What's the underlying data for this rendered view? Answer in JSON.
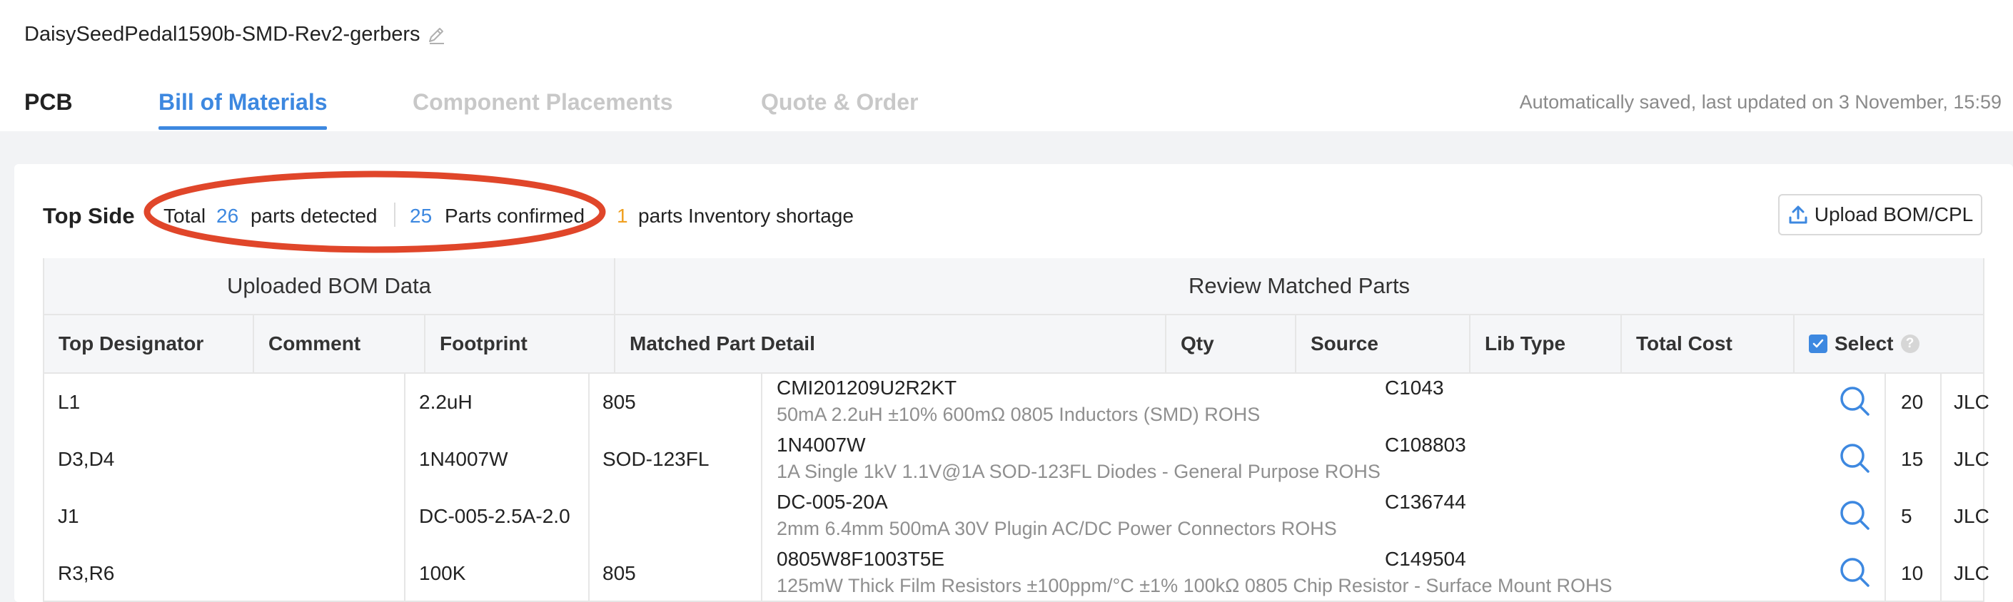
{
  "header": {
    "project_title": "DaisySeedPedal1590b-SMD-Rev2-gerbers",
    "autosave": "Automatically saved, last updated on 3 November, 15:59"
  },
  "tabs": [
    {
      "label": "PCB",
      "state": "normal"
    },
    {
      "label": "Bill of Materials",
      "state": "active"
    },
    {
      "label": "Component Placements",
      "state": "disabled"
    },
    {
      "label": "Quote & Order",
      "state": "disabled"
    }
  ],
  "summary": {
    "title": "Top Side",
    "total_label": "Total",
    "total_count": "26",
    "detected_label": "parts detected",
    "confirmed_count": "25",
    "confirmed_label": "Parts confirmed",
    "shortage_count": "1",
    "shortage_label": "parts Inventory shortage"
  },
  "upload_button": {
    "label": "Upload BOM/CPL"
  },
  "table": {
    "group_headers": {
      "uploaded": "Uploaded BOM Data",
      "review": "Review Matched Parts"
    },
    "columns": [
      "Top Designator",
      "Comment",
      "Footprint",
      "Matched Part Detail",
      "Qty",
      "Source",
      "Lib Type",
      "Total Cost",
      "Select"
    ],
    "rows": [
      {
        "designator": "L1",
        "comment": "2.2uH",
        "footprint": "805",
        "part": "CMI201209U2R2KT",
        "desc": "50mA 2.2uH ±10% 600mΩ 0805 Inductors (SMD) ROHS",
        "lcsc": "C1043",
        "qty": "20",
        "source": "JLC"
      },
      {
        "designator": "D3,D4",
        "comment": "1N4007W",
        "footprint": "SOD-123FL",
        "part": "1N4007W",
        "desc": "1A Single 1kV 1.1V@1A SOD-123FL Diodes - General Purpose ROHS",
        "lcsc": "C108803",
        "qty": "15",
        "source": "JLC"
      },
      {
        "designator": "J1",
        "comment": "DC-005-2.5A-2.0",
        "footprint": "",
        "part": "DC-005-20A",
        "desc": "2mm 6.4mm 500mA 30V Plugin AC/DC Power Connectors ROHS",
        "lcsc": "C136744",
        "qty": "5",
        "source": "JLC"
      },
      {
        "designator": "R3,R6",
        "comment": "100K",
        "footprint": "805",
        "part": "0805W8F1003T5E",
        "desc": "125mW Thick Film Resistors ±100ppm/°C ±1% 100kΩ 0805 Chip Resistor - Surface Mount ROHS",
        "lcsc": "C149504",
        "qty": "10",
        "source": "JLC"
      }
    ]
  },
  "colors": {
    "accent": "#3d88e0",
    "warning": "#f0a020",
    "annotation": "#e0462a"
  },
  "icons": [
    "edit-icon",
    "upload-icon",
    "search-icon",
    "checkbox-checked-icon",
    "help-icon"
  ]
}
